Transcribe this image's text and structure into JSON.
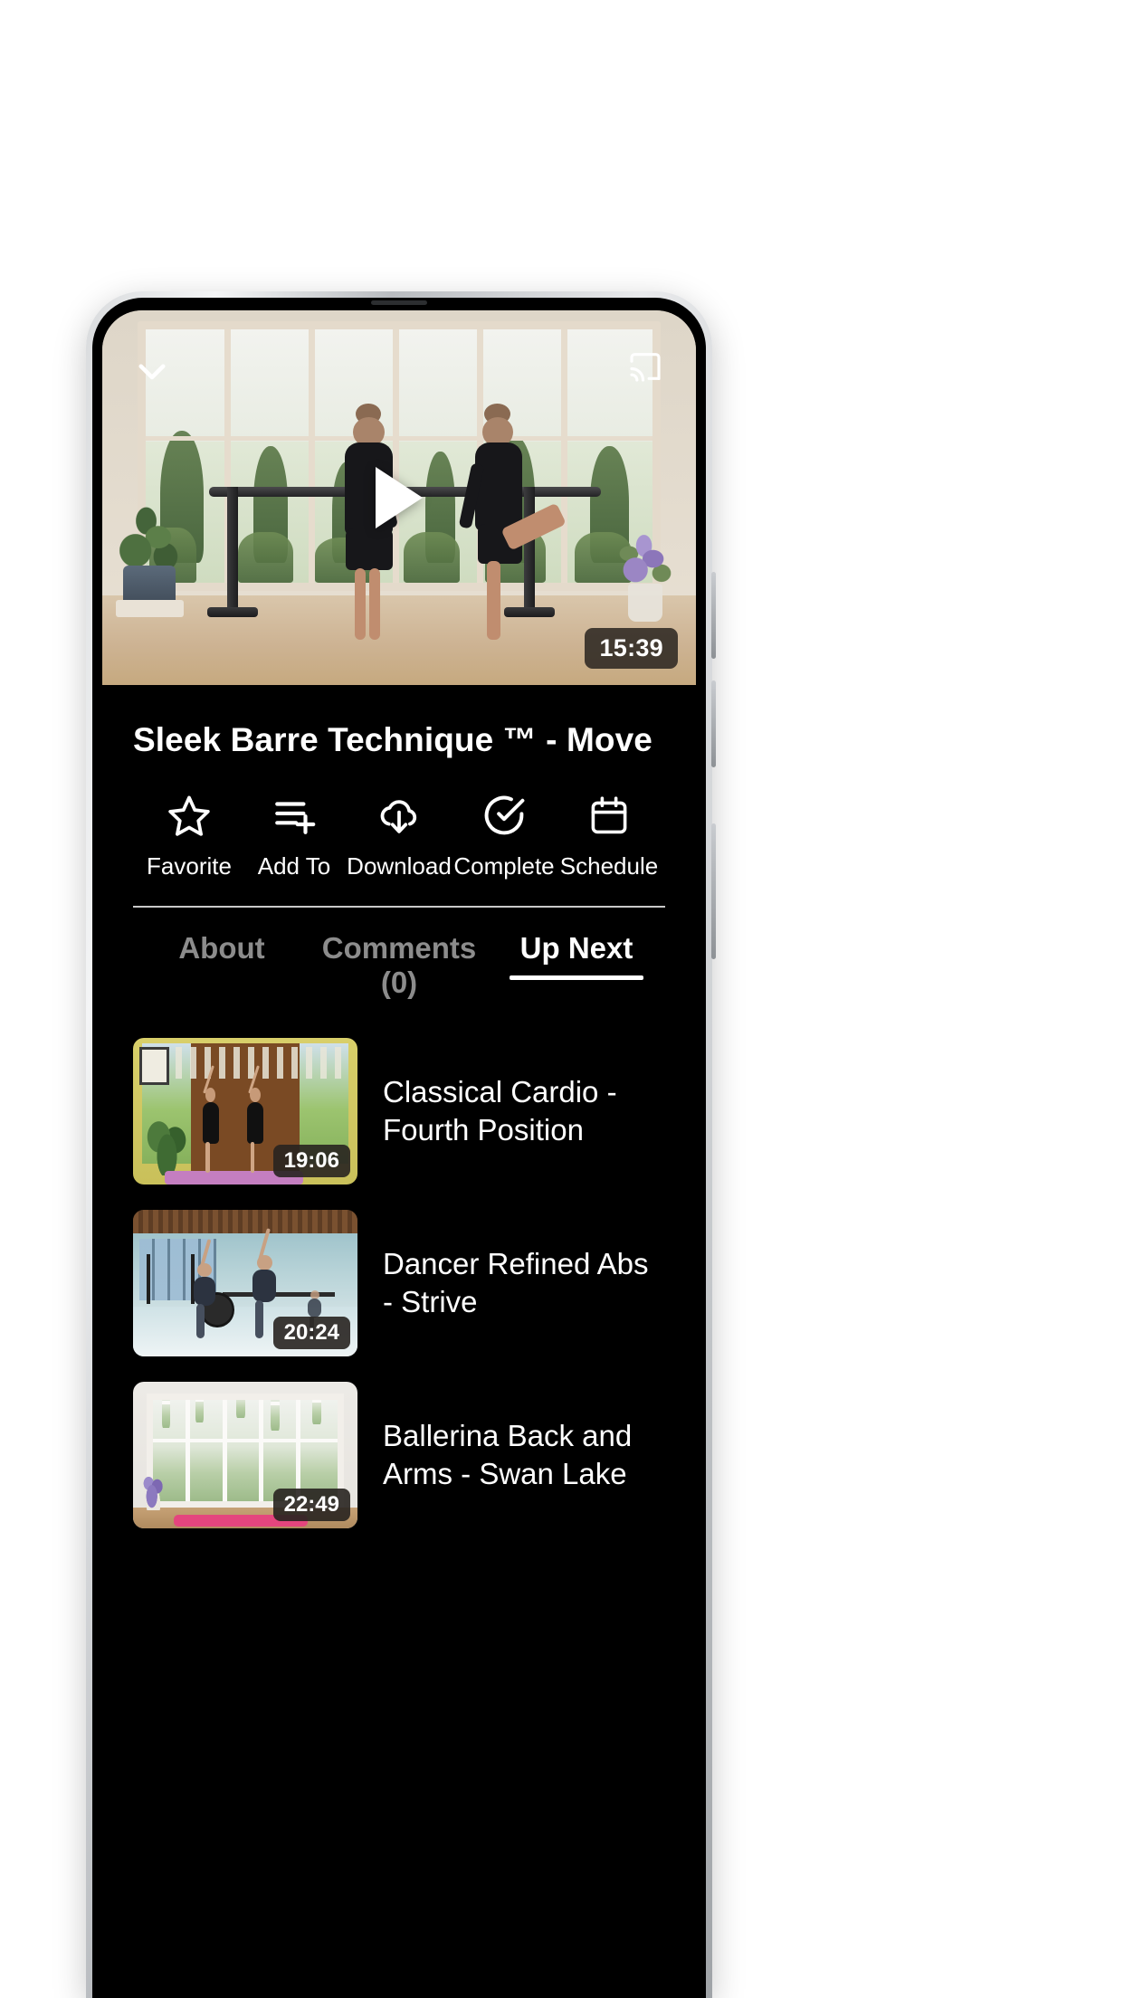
{
  "player": {
    "collapse_icon": "chevron-down-icon",
    "cast_icon": "cast-icon",
    "play_icon": "play-icon",
    "duration": "15:39"
  },
  "video": {
    "title": "Sleek Barre Technique ™ - Move"
  },
  "actions": [
    {
      "label": "Favorite",
      "icon": "star-icon"
    },
    {
      "label": "Add To",
      "icon": "playlist-add-icon"
    },
    {
      "label": "Download",
      "icon": "cloud-download-icon"
    },
    {
      "label": "Complete",
      "icon": "check-circle-icon"
    },
    {
      "label": "Schedule",
      "icon": "calendar-icon"
    }
  ],
  "tabs": [
    {
      "label": "About",
      "active": false
    },
    {
      "label": "Comments (0)",
      "active": false
    },
    {
      "label": "Up Next",
      "active": true
    }
  ],
  "up_next": [
    {
      "title": "Classical Cardio - Fourth Position",
      "duration": "19:06"
    },
    {
      "title": "Dancer Refined Abs - Strive",
      "duration": "20:24"
    },
    {
      "title": "Ballerina Back and Arms - Swan Lake",
      "duration": "22:49"
    }
  ],
  "colors": {
    "background": "#000000",
    "text_primary": "#ffffff",
    "text_muted": "#8c8c8c",
    "divider": "#c9c9c9",
    "badge_bg": "#2d2822"
  }
}
